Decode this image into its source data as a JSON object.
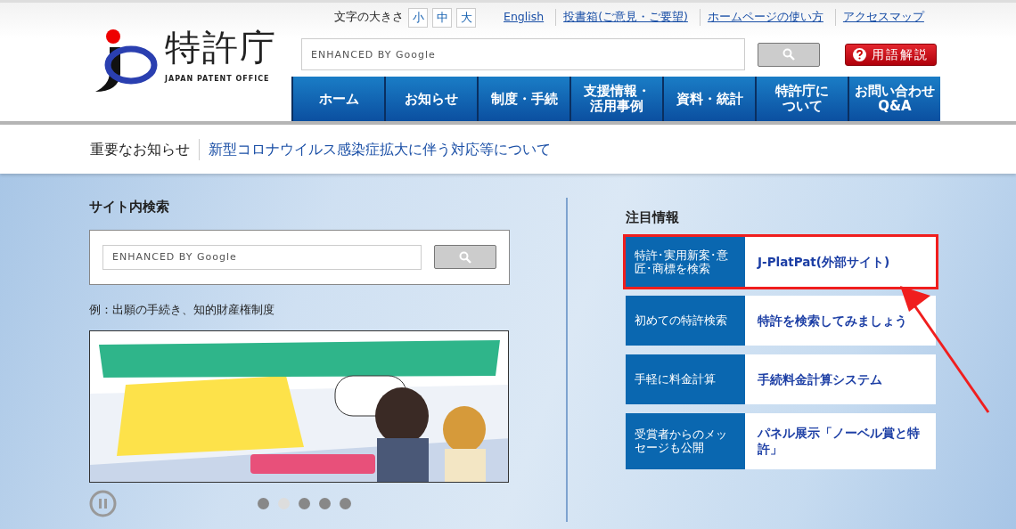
{
  "header": {
    "logo": {
      "name": "特許庁",
      "subtitle": "JAPAN PATENT OFFICE"
    },
    "font_size": {
      "label": "文字の大きさ",
      "options": [
        {
          "label": "小"
        },
        {
          "label": "中"
        },
        {
          "label": "大"
        }
      ]
    },
    "links": [
      "English",
      "投書箱(ご意見・ご要望)",
      "ホームページの使い方",
      "アクセスマップ"
    ],
    "search": {
      "placeholder": "ENHANCED BY Google"
    },
    "glossary_button": "用語解説",
    "nav": [
      {
        "lines": [
          "ホーム"
        ]
      },
      {
        "lines": [
          "お知らせ"
        ]
      },
      {
        "lines": [
          "制度・手続"
        ]
      },
      {
        "lines": [
          "支援情報・",
          "活用事例"
        ]
      },
      {
        "lines": [
          "資料・統計"
        ]
      },
      {
        "lines": [
          "特許庁に",
          "ついて"
        ]
      },
      {
        "lines": [
          "お問い合わせ",
          "Q&A"
        ]
      }
    ]
  },
  "notice": {
    "label": "重要なお知らせ",
    "link": "新型コロナウイルス感染症拡大に伴う対応等について"
  },
  "site_search": {
    "title": "サイト内検索",
    "placeholder": "ENHANCED BY Google",
    "example": "例：出願の手続き、知的財産権制度"
  },
  "banner": {
    "kind": "picture",
    "dots": [
      {
        "selected": false
      },
      {
        "selected": true
      },
      {
        "selected": false
      },
      {
        "selected": false
      },
      {
        "selected": false
      }
    ]
  },
  "featured": {
    "title": "注目情報",
    "items": [
      {
        "label": "特許･実用新案･意匠･商標を検索",
        "link": "J-PlatPat(外部サイト)",
        "highlighted": true
      },
      {
        "label": "初めての特許検索",
        "link": "特許を検索してみましょう",
        "highlighted": false
      },
      {
        "label": "手軽に料金計算",
        "link": "手続料金計算システム",
        "highlighted": false
      },
      {
        "label": "受賞者からのメッセージも公開",
        "link": "パネル展示「ノーベル賞と特許」",
        "highlighted": false
      }
    ]
  }
}
